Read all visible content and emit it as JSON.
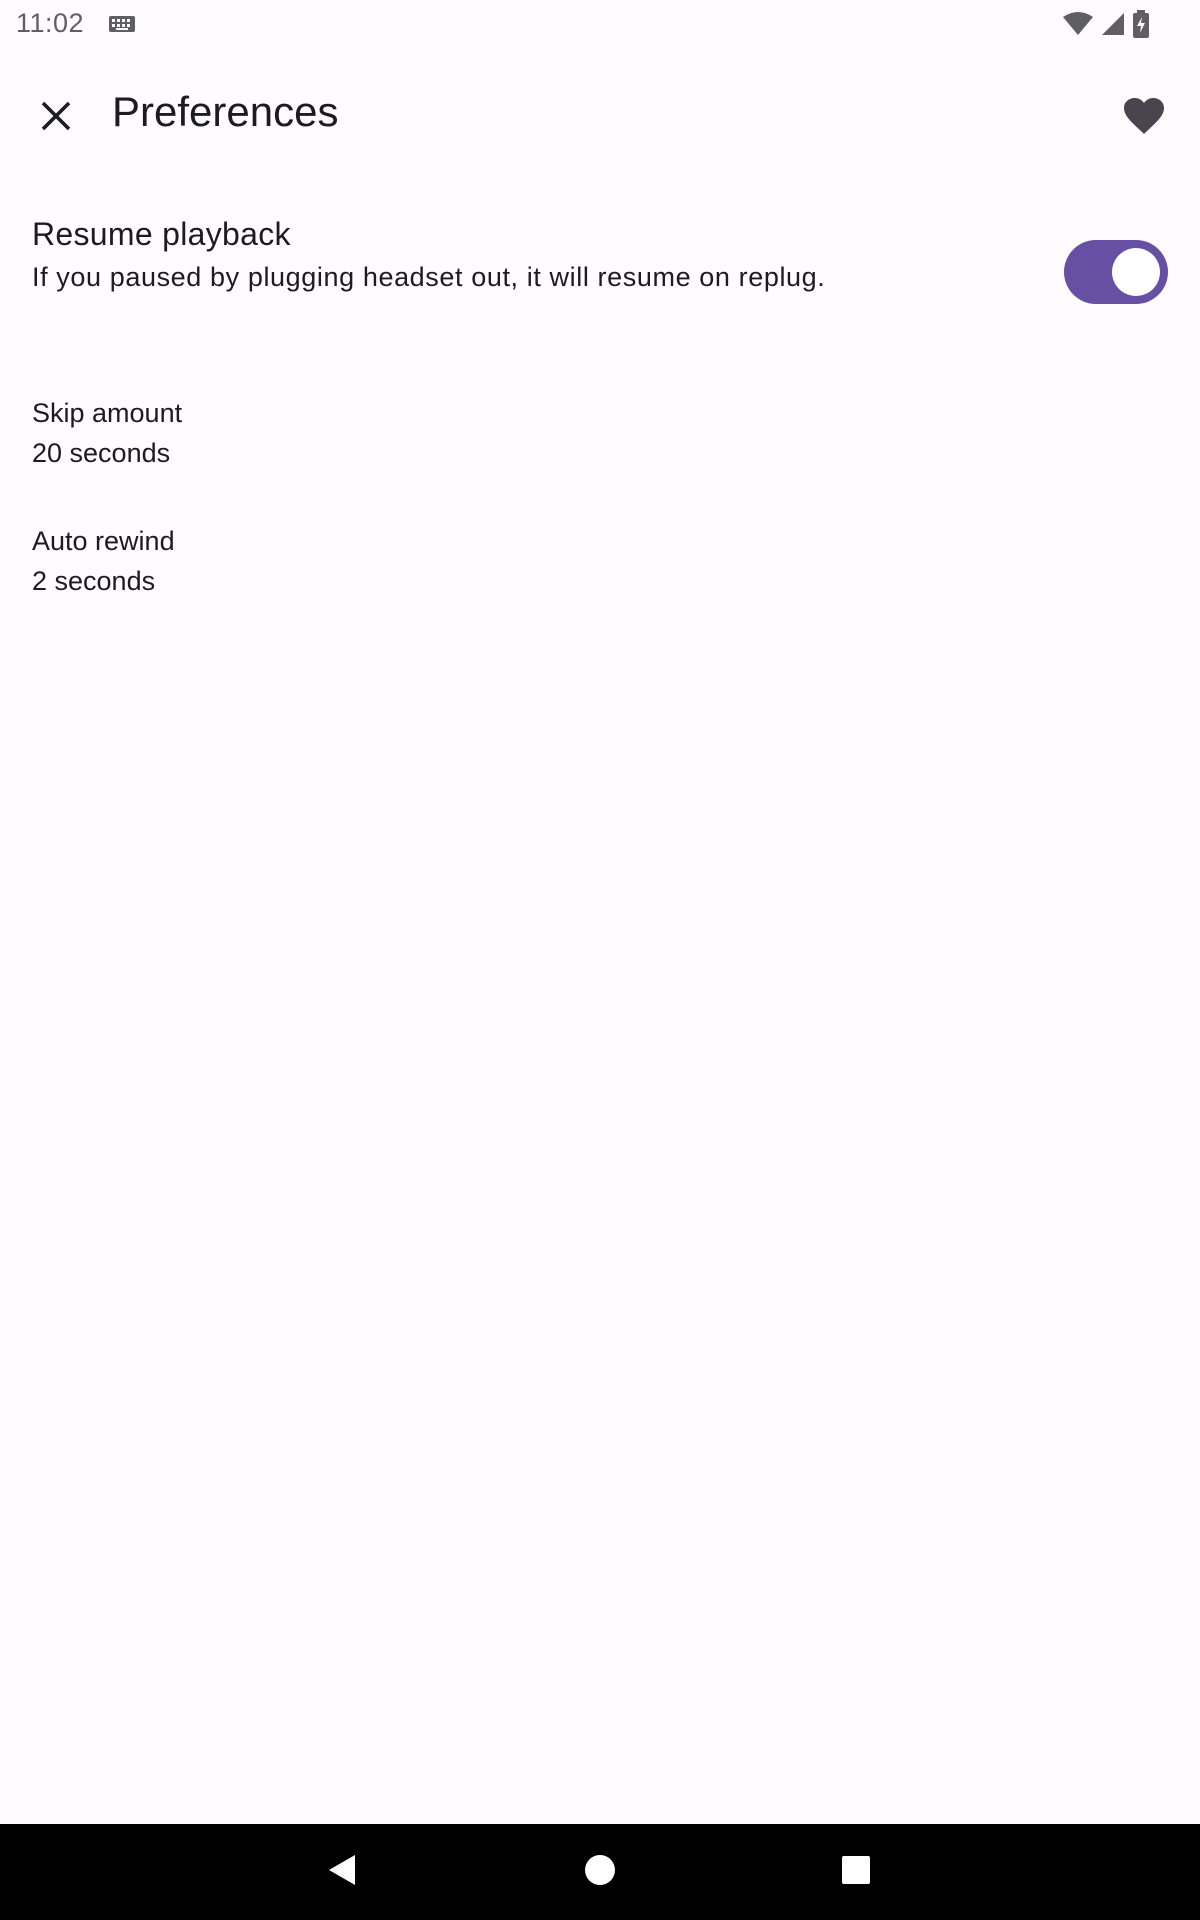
{
  "status_bar": {
    "time": "11:02",
    "icons": [
      "keyboard-icon",
      "wifi-icon",
      "cellular-signal-icon",
      "battery-charging-icon"
    ]
  },
  "app_bar": {
    "title": "Preferences",
    "close_icon": "close-icon",
    "favorite_icon": "heart-icon"
  },
  "preferences": {
    "resume_playback": {
      "title": "Resume playback",
      "summary": "If you paused by plugging headset out, it will resume on replug.",
      "enabled": true
    },
    "skip_amount": {
      "title": "Skip amount",
      "value": "20 seconds"
    },
    "auto_rewind": {
      "title": "Auto rewind",
      "value": "2 seconds"
    }
  },
  "colors": {
    "accent": "#6750a4",
    "background": "#fffbfe",
    "nav_bar": "#000000"
  },
  "nav_bar": {
    "icons": [
      "back-icon",
      "home-icon",
      "recents-icon"
    ]
  }
}
